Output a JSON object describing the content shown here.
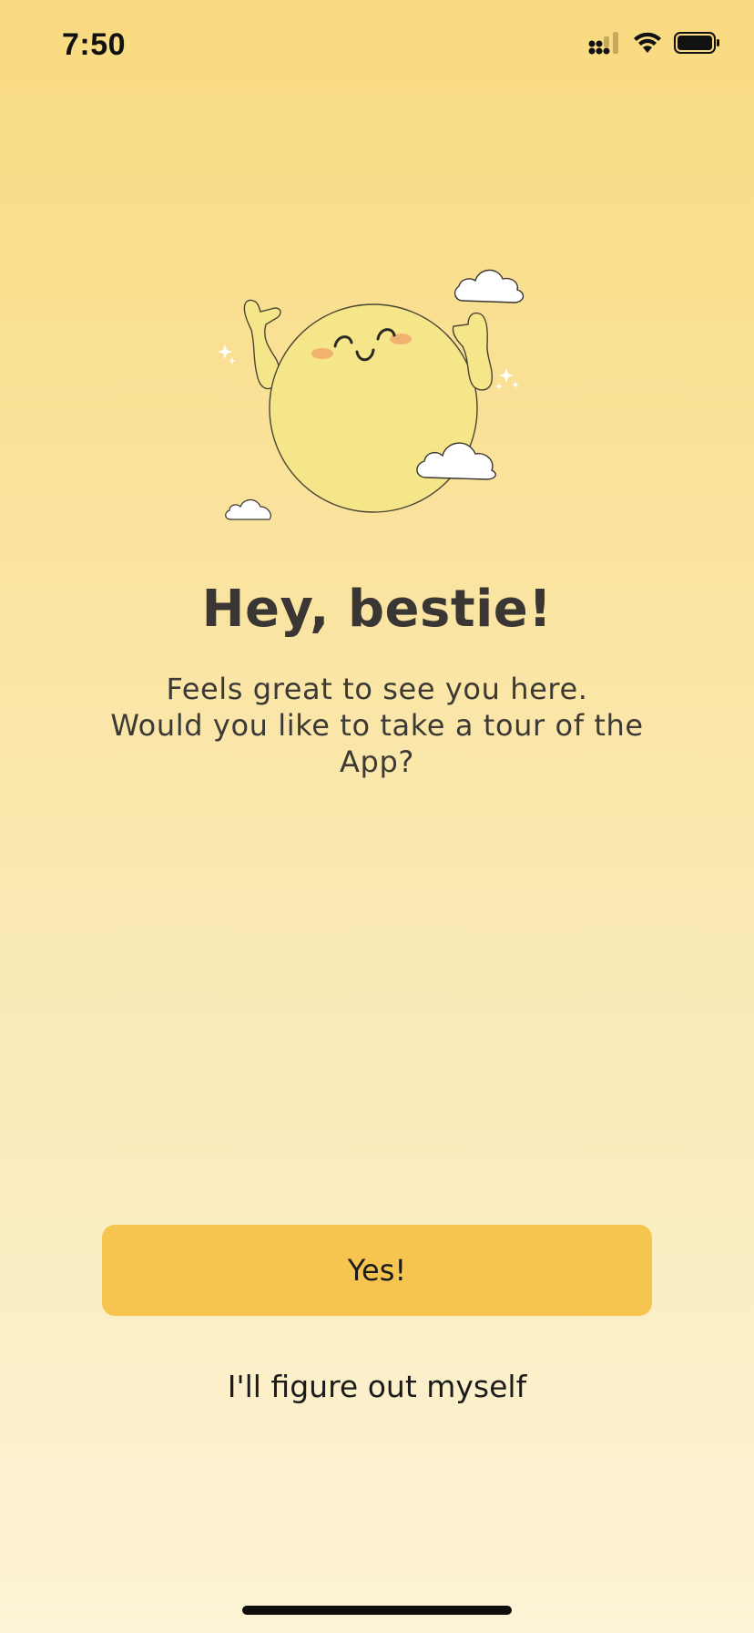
{
  "status_bar": {
    "time": "7:50",
    "icons": [
      "cellular-signal-icon",
      "wifi-icon",
      "battery-icon"
    ]
  },
  "hero": {
    "illustration": "smiling-sun-with-clouds",
    "colors": {
      "sun": "#f5e68a",
      "cheeks": "#f0a86a",
      "cloud": "#ffffff"
    }
  },
  "onboarding": {
    "title": "Hey, bestie!",
    "subtitle_line1": "Feels great to see you here.",
    "subtitle_line2": "Would you like to take a tour of the",
    "subtitle_line3": "App?"
  },
  "actions": {
    "yes_label": "Yes!",
    "skip_label": "I'll figure out myself"
  },
  "colors": {
    "background_top": "#f9da80",
    "background_bottom": "#fcf3d6",
    "primary_button": "#f5c54f"
  }
}
